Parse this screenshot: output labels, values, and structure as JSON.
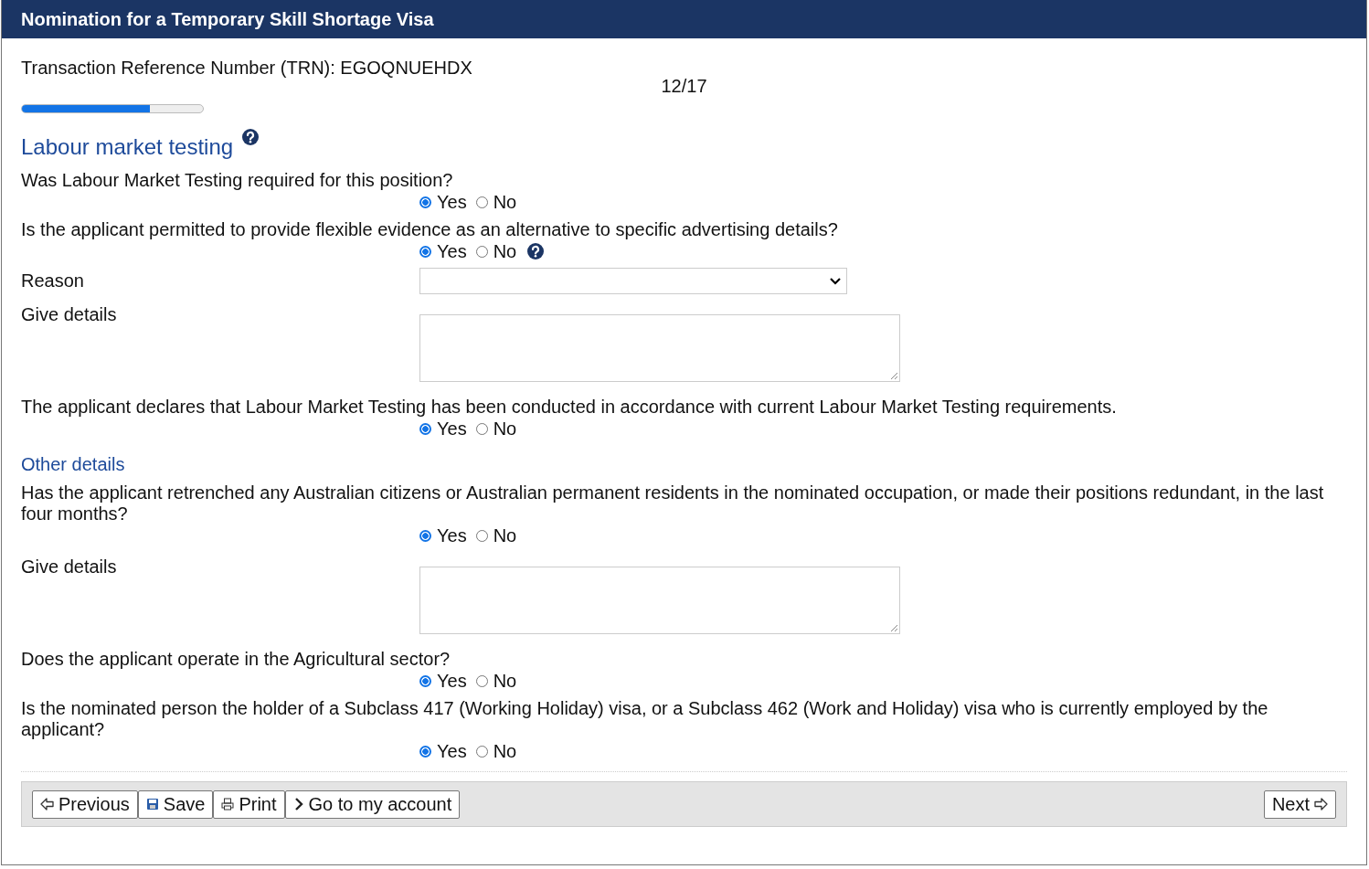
{
  "window": {
    "title": "Nomination for a Temporary Skill Shortage Visa"
  },
  "trn": "Transaction Reference Number (TRN): EGOQNUEHDX",
  "progress": {
    "label": "12/17",
    "level": 0.706
  },
  "items": [
    {
      "kind": "heading",
      "text": "Labour market testing",
      "help": true
    },
    {
      "kind": "question",
      "text": "Was Labour Market Testing required for this position?",
      "help": false,
      "options": [
        {
          "label": "Yes",
          "selected": true
        },
        {
          "label": "No",
          "selected": false
        }
      ]
    },
    {
      "kind": "question",
      "text": "Is the applicant permitted to provide flexible evidence as an alternative to specific advertising details?",
      "help": true,
      "options": [
        {
          "label": "Yes",
          "selected": true
        },
        {
          "label": "No",
          "selected": false
        }
      ]
    },
    {
      "kind": "select",
      "text": "Reason"
    },
    {
      "kind": "textarea",
      "text": "Give details"
    },
    {
      "kind": "question",
      "text": "The applicant declares that Labour Market Testing has been conducted in accordance with current Labour Market Testing requirements.",
      "help": false,
      "options": [
        {
          "label": "Yes",
          "selected": true
        },
        {
          "label": "No",
          "selected": false
        }
      ]
    },
    {
      "kind": "subheading",
      "text": "Other details"
    },
    {
      "kind": "question",
      "text": "Has the applicant retrenched any Australian citizens or Australian permanent residents in the nominated occupation, or made their positions redundant, in the last four months?",
      "help": false,
      "options": [
        {
          "label": "Yes",
          "selected": true
        },
        {
          "label": "No",
          "selected": false
        }
      ]
    },
    {
      "kind": "textarea",
      "text": "Give details"
    },
    {
      "kind": "question",
      "text": "Does the applicant operate in the Agricultural sector?",
      "help": false,
      "options": [
        {
          "label": "Yes",
          "selected": true
        },
        {
          "label": "No",
          "selected": false
        }
      ]
    },
    {
      "kind": "question",
      "text": "Is the nominated person the holder of a Subclass 417 (Working Holiday) visa, or a Subclass 462 (Work and Holiday) visa who is currently employed by the applicant?",
      "help": false,
      "options": [
        {
          "label": "Yes",
          "selected": true
        },
        {
          "label": "No",
          "selected": false
        }
      ]
    }
  ],
  "footer": {
    "left": [
      {
        "kind": "previous",
        "label": "Previous"
      },
      {
        "kind": "save",
        "label": "Save"
      },
      {
        "kind": "print",
        "label": "Print"
      },
      {
        "kind": "account",
        "label": "Go to my account"
      }
    ],
    "right": [
      {
        "kind": "next",
        "label": "Next"
      }
    ]
  }
}
